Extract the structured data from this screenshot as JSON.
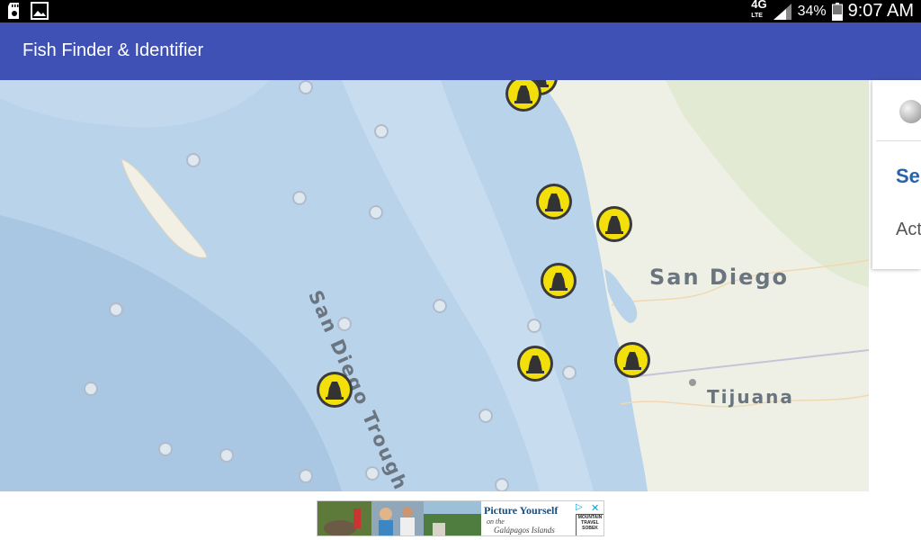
{
  "status_bar": {
    "left_icons": [
      "sd-card-icon",
      "image-icon"
    ],
    "network": "4G",
    "network_sub": "LTE",
    "battery_percent": "34%",
    "time": "9:07 AM"
  },
  "app_bar": {
    "title": "Fish Finder & Identifier"
  },
  "map": {
    "labels": {
      "trough": "San Diego Trough",
      "city1": "San Diego",
      "city2": "Tijuana"
    },
    "colors": {
      "ocean": "#b9d3ea",
      "land": "#eef0e6",
      "marker_fill": "#f3e00a",
      "marker_border": "#3a3a3a"
    },
    "marker_icon": "fishing-spot-marker-icon",
    "poi_icon": "seamount-poi-icon"
  },
  "side_panel": {
    "search_label": "Se",
    "action_label": "Act"
  },
  "ad": {
    "headline": "Picture Yourself",
    "sub_on": "on the",
    "sub_place": "Galápagos Islands",
    "brand_lines": [
      "MOUNTAIN",
      "TRAVEL",
      "SOBEK"
    ],
    "choice_icon": "ad-choices-icon",
    "close_icon": "close-icon"
  }
}
